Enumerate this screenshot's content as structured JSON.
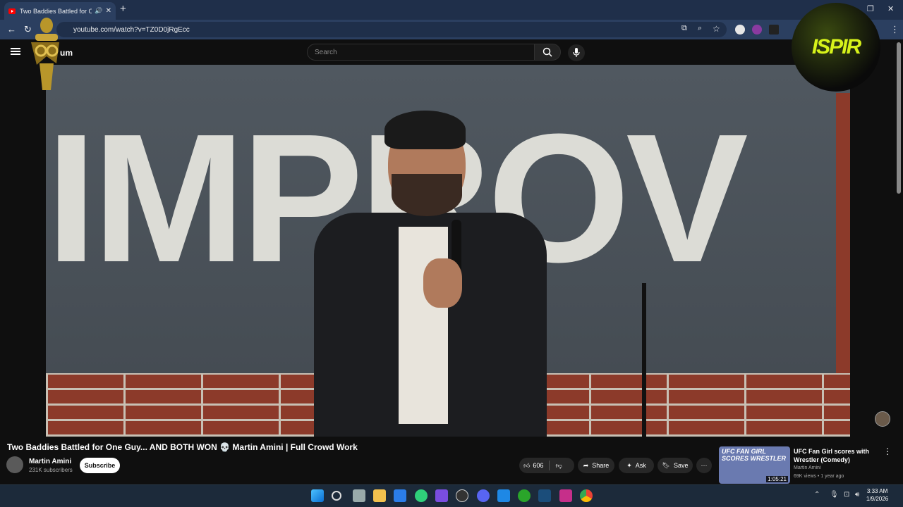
{
  "browser": {
    "tab_title": "Two Baddies Battled for One",
    "url": "youtube.com/watch?v=TZ0D0jRgEcc",
    "new_tab": "+",
    "tab_audio": "🔊",
    "tab_close": "✕"
  },
  "youtube": {
    "brand": "um",
    "search_placeholder": "Search"
  },
  "video": {
    "sign_text": "IMPROV",
    "title": "Two Baddies Battled for One Guy... AND BOTH WON 💀 Martin Amini | Full Crowd Work",
    "channel": "Martin Amini",
    "subscribers": "231K subscribers",
    "subscribe_label": "Subscribe",
    "like_count": "606",
    "share_label": "Share",
    "ask_label": "Ask",
    "save_label": "Save",
    "more_label": "···"
  },
  "overlays": {
    "right_logo_text": "ISPIR"
  },
  "recommendation": {
    "thumb_text": "UFC FAN GIRL SCORES WRESTLER",
    "duration": "1:05:21",
    "title": "UFC Fan Girl scores with Wrestler (Comedy)",
    "channel": "Martin Amini",
    "meta": "69K views • 1 year ago"
  },
  "taskbar": {
    "time": "3:33 AM",
    "date": "1/9/2026"
  },
  "colors": {
    "yt_bg": "#0f0f0f",
    "chrome_frame": "#1f2f4a",
    "taskbar": "#1c2a3a",
    "brick": "#8c3a2a"
  }
}
